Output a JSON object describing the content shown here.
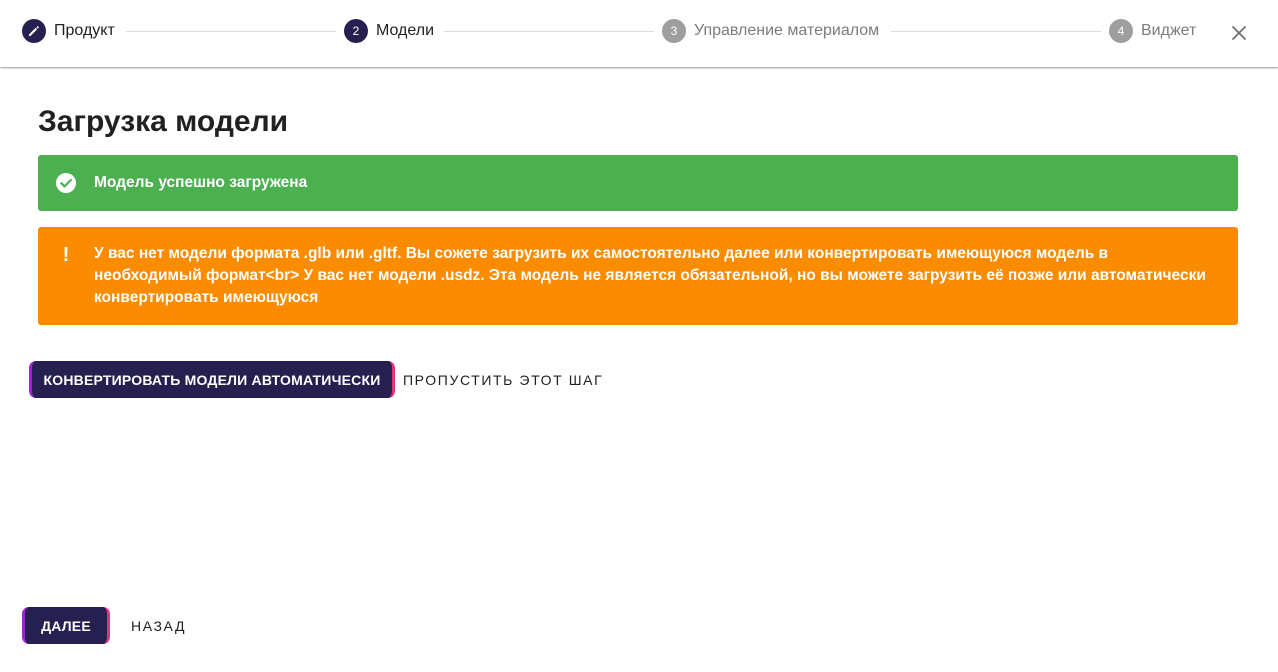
{
  "stepper": {
    "steps": [
      {
        "number": "",
        "label": "Продукт",
        "state": "completed",
        "icon": "pencil-icon"
      },
      {
        "number": "2",
        "label": "Модели",
        "state": "active"
      },
      {
        "number": "3",
        "label": "Управление материалом",
        "state": "inactive"
      },
      {
        "number": "4",
        "label": "Виджет",
        "state": "inactive"
      }
    ],
    "close_icon": "close-icon"
  },
  "main": {
    "title": "Загрузка модели",
    "success_alert": {
      "icon": "check-circle-icon",
      "text": "Модель успешно загружена"
    },
    "warning_alert": {
      "icon": "exclamation-icon",
      "icon_glyph": "!",
      "text": "У вас нет модели формата .glb или .gltf. Вы сожете загрузить их самостоятельно далее или конвертировать имеющуюся модель в необходимый формат<br> У вас нет модели .usdz. Эта модель не является обязательной, но вы можете загрузить её позже или автоматически конвертировать имеющуюся"
    },
    "convert_button": "КОНВЕРТИРОВАТЬ МОДЕЛИ АВТОМАТИЧЕСКИ",
    "skip_button": "ПРОПУСТИТЬ ЭТОТ ШАГ"
  },
  "footer": {
    "next_button": "ДАЛЕЕ",
    "back_button": "НАЗАД"
  },
  "colors": {
    "primary": "#25204f",
    "success": "#4caf50",
    "warning": "#fb8c00",
    "inactive_step": "#9e9e9e"
  }
}
